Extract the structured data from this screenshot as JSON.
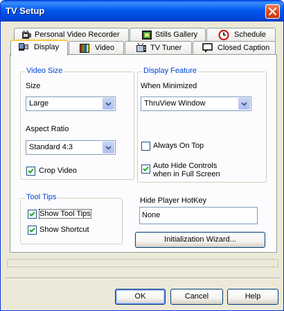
{
  "window": {
    "title": "TV Setup"
  },
  "tabs_row1": [
    {
      "label": "Personal Video Recorder",
      "icon": "film-reel-icon"
    },
    {
      "label": "Stills Gallery",
      "icon": "gallery-icon"
    },
    {
      "label": "Schedule",
      "icon": "clock-icon"
    }
  ],
  "tabs_row2": [
    {
      "label": "Display",
      "icon": "display-icon",
      "active": true
    },
    {
      "label": "Video",
      "icon": "video-bars-icon"
    },
    {
      "label": "TV Tuner",
      "icon": "tv-tuner-icon"
    },
    {
      "label": "Closed Caption",
      "icon": "caption-icon"
    }
  ],
  "video_size": {
    "legend": "Video Size",
    "size_label": "Size",
    "size_value": "Large",
    "aspect_label": "Aspect Ratio",
    "aspect_value": "Standard 4:3",
    "crop_label": "Crop Video",
    "crop_checked": true
  },
  "display_feature": {
    "legend": "Display Feature",
    "minimized_label": "When Minimized",
    "minimized_value": "ThruView Window",
    "always_on_top_label": "Always On Top",
    "always_on_top_checked": false,
    "auto_hide_line1": "Auto Hide Controls",
    "auto_hide_line2": "when in Full Screen",
    "auto_hide_checked": true
  },
  "tool_tips": {
    "legend": "Tool Tips",
    "show_tool_tips_label": "Show Tool Tips",
    "show_tool_tips_checked": true,
    "show_shortcut_label": "Show Shortcut",
    "show_shortcut_checked": true
  },
  "hotkey": {
    "label": "Hide Player HotKey",
    "value": "None"
  },
  "init_wizard_label": "Initialization Wizard...",
  "buttons": {
    "ok": "OK",
    "cancel": "Cancel",
    "help": "Help"
  },
  "colors": {
    "title_bar": "#0058ee",
    "legend_text": "#0046d5",
    "active_tab_highlight": "#ffc83c",
    "close_button": "#d84a22"
  }
}
